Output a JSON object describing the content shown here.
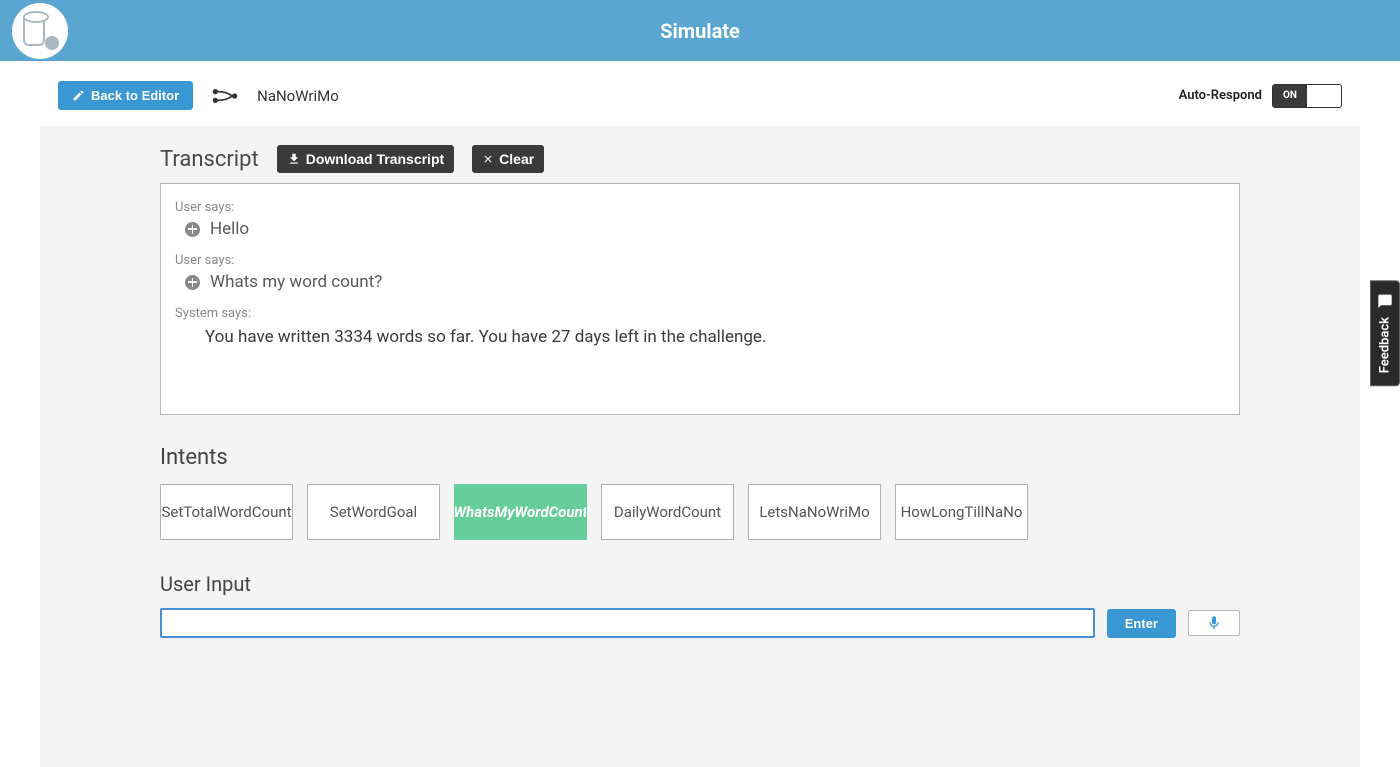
{
  "header": {
    "title": "Simulate"
  },
  "toolbar": {
    "back_label": "Back to Editor",
    "project_name": "NaNoWriMo",
    "auto_respond_label": "Auto-Respond",
    "toggle_state_on": "ON"
  },
  "transcript": {
    "title": "Transcript",
    "download_label": "Download Transcript",
    "clear_label": "Clear",
    "messages": [
      {
        "speaker": "User says:",
        "text": "Hello",
        "has_expand": true
      },
      {
        "speaker": "User says:",
        "text": "Whats my word count?",
        "has_expand": true
      },
      {
        "speaker": "System says:",
        "text": "You have written 3334 words so far. You have 27 days left in the challenge.",
        "has_expand": false
      }
    ]
  },
  "intents": {
    "title": "Intents",
    "items": [
      {
        "label": "SetTotalWordCount",
        "active": false
      },
      {
        "label": "SetWordGoal",
        "active": false
      },
      {
        "label": "WhatsMyWordCount",
        "active": true
      },
      {
        "label": "DailyWordCount",
        "active": false
      },
      {
        "label": "LetsNaNoWriMo",
        "active": false
      },
      {
        "label": "HowLongTillNaNo",
        "active": false
      }
    ]
  },
  "user_input": {
    "title": "User Input",
    "value": "",
    "enter_label": "Enter"
  },
  "feedback": {
    "label": "Feedback"
  }
}
